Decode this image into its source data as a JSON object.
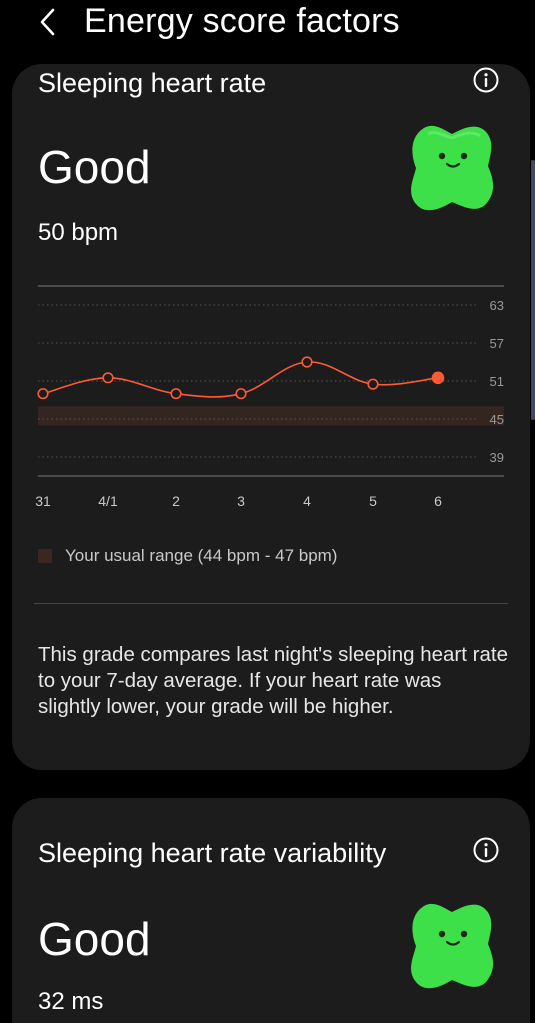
{
  "header": {
    "title": "Energy score factors",
    "back_icon": "chevron-left-icon"
  },
  "cards": [
    {
      "title": "Sleeping heart rate",
      "grade": "Good",
      "value": "50 bpm",
      "legend": "Your usual range (44 bpm - 47 bpm)",
      "description": "This grade compares last night's sleeping heart rate to your 7-day average. If your heart rate was slightly lower, your grade will be higher."
    },
    {
      "title": "Sleeping heart rate variability",
      "grade": "Good",
      "value": "32 ms"
    }
  ],
  "colors": {
    "accent": "#ff5a36",
    "card": "#1c1c1c",
    "range": "#3a2722",
    "mascot": "#3ee04a"
  },
  "chart_data": {
    "type": "line",
    "categories": [
      "31",
      "4/1",
      "2",
      "3",
      "4",
      "5",
      "6"
    ],
    "values": [
      49,
      51.5,
      49,
      49,
      54,
      50.5,
      51.5
    ],
    "yticks": [
      63,
      57,
      51,
      45,
      39
    ],
    "ylim": [
      39,
      63
    ],
    "usual_range": [
      44,
      47
    ],
    "grid": true
  }
}
